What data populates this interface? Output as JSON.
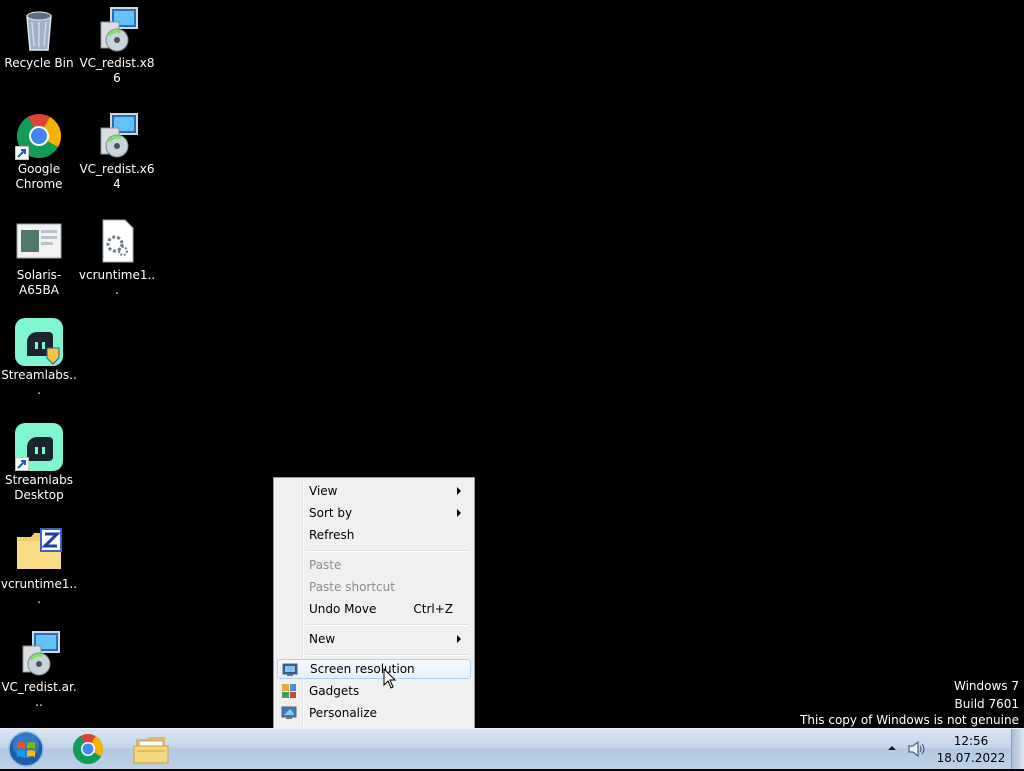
{
  "desktop": {
    "icons": [
      {
        "label": "Recycle Bin",
        "icon": "recycle-bin-icon"
      },
      {
        "label": "VC_redist.x86",
        "icon": "installer-icon"
      },
      {
        "label": "Google Chrome",
        "icon": "chrome-icon"
      },
      {
        "label": "VC_redist.x64",
        "icon": "installer-icon"
      },
      {
        "label": "Solaris-A65BA",
        "icon": "screenshot-file-icon"
      },
      {
        "label": "vcruntime1...",
        "icon": "dll-file-icon"
      },
      {
        "label": "Streamlabs...",
        "icon": "streamlabs-icon"
      },
      {
        "label": "Streamlabs Desktop",
        "icon": "streamlabs-icon"
      },
      {
        "label": "vcruntime1...",
        "icon": "zip-folder-icon"
      },
      {
        "label": "VC_redist.ar...",
        "icon": "installer-icon"
      }
    ]
  },
  "context_menu": {
    "items": [
      {
        "label": "View",
        "submenu": true
      },
      {
        "label": "Sort by",
        "submenu": true
      },
      {
        "label": "Refresh"
      },
      {
        "label": "Paste",
        "disabled": true
      },
      {
        "label": "Paste shortcut",
        "disabled": true
      },
      {
        "label": "Undo Move",
        "accel": "Ctrl+Z"
      },
      {
        "label": "New",
        "submenu": true
      },
      {
        "label": "Screen resolution",
        "icon": "monitor-icon",
        "hover": true
      },
      {
        "label": "Gadgets",
        "icon": "gadgets-icon"
      },
      {
        "label": "Personalize",
        "icon": "personalize-icon"
      }
    ]
  },
  "watermark": {
    "line1": "Windows 7",
    "line2": "Build 7601",
    "line3": "This copy of Windows is not genuine"
  },
  "taskbar": {
    "pinned": [
      "chrome-icon",
      "explorer-folder-icon"
    ],
    "clock_time": "12:56",
    "clock_date": "18.07.2022"
  }
}
